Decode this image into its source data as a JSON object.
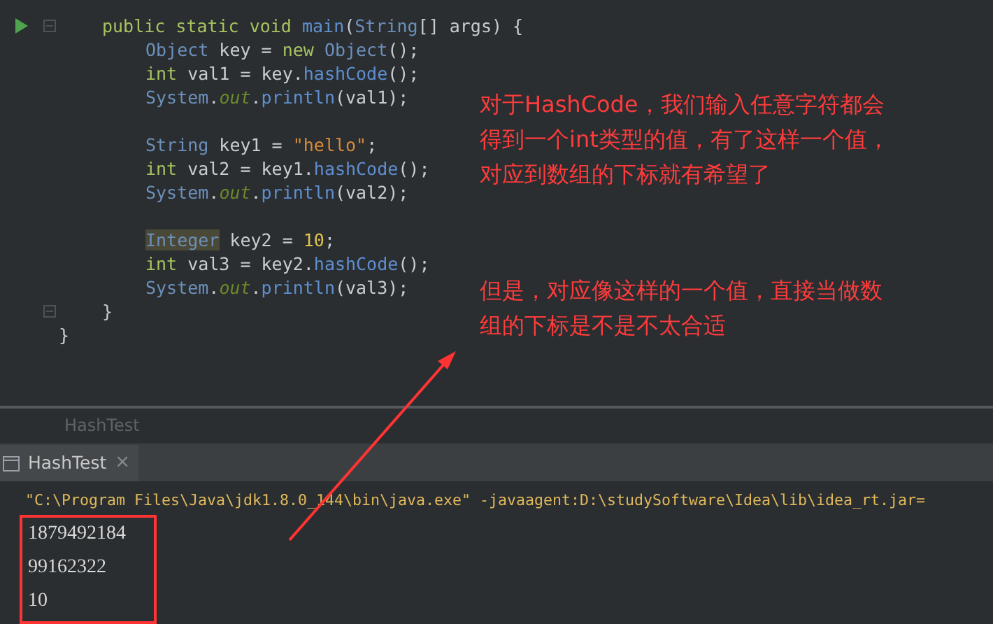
{
  "editor": {
    "lines": [
      {
        "children": [
          {
            "run": true,
            "fold": true,
            "tokens": [
              {
                "kind": "keyword",
                "text": "public static void "
              },
              {
                "kind": "method",
                "text": "main"
              },
              {
                "kind": "plain",
                "text": "("
              },
              {
                "kind": "type",
                "text": "String"
              },
              {
                "kind": "plain",
                "text": "[] args) {"
              }
            ],
            "children": [
              {
                "tokens": [
                  {
                    "kind": "type",
                    "text": "Object"
                  },
                  {
                    "kind": "plain",
                    "text": " key = "
                  },
                  {
                    "kind": "keyword",
                    "text": "new "
                  },
                  {
                    "kind": "type",
                    "text": "Object"
                  },
                  {
                    "kind": "plain",
                    "text": "();"
                  }
                ]
              },
              {
                "tokens": [
                  {
                    "kind": "keyword",
                    "text": "int"
                  },
                  {
                    "kind": "plain",
                    "text": " val1 = key."
                  },
                  {
                    "kind": "method",
                    "text": "hashCode"
                  },
                  {
                    "kind": "plain",
                    "text": "();"
                  }
                ]
              },
              {
                "tokens": [
                  {
                    "kind": "type",
                    "text": "System"
                  },
                  {
                    "kind": "plain",
                    "text": "."
                  },
                  {
                    "kind": "static",
                    "text": "out"
                  },
                  {
                    "kind": "plain",
                    "text": "."
                  },
                  {
                    "kind": "method",
                    "text": "println"
                  },
                  {
                    "kind": "plain",
                    "text": "(val1);"
                  }
                ]
              },
              {
                "gap_before": true,
                "tokens": [
                  {
                    "kind": "type",
                    "text": "String"
                  },
                  {
                    "kind": "plain",
                    "text": " key1 = "
                  },
                  {
                    "kind": "string",
                    "text": "\"hello\""
                  },
                  {
                    "kind": "plain",
                    "text": ";"
                  }
                ]
              },
              {
                "tokens": [
                  {
                    "kind": "keyword",
                    "text": "int"
                  },
                  {
                    "kind": "plain",
                    "text": " val2 = key1."
                  },
                  {
                    "kind": "method",
                    "text": "hashCode"
                  },
                  {
                    "kind": "plain",
                    "text": "();"
                  }
                ]
              },
              {
                "tokens": [
                  {
                    "kind": "type",
                    "text": "System"
                  },
                  {
                    "kind": "plain",
                    "text": "."
                  },
                  {
                    "kind": "static",
                    "text": "out"
                  },
                  {
                    "kind": "plain",
                    "text": "."
                  },
                  {
                    "kind": "method",
                    "text": "println"
                  },
                  {
                    "kind": "plain",
                    "text": "(val2);"
                  }
                ]
              },
              {
                "gap_before": true,
                "tokens": [
                  {
                    "kind": "highlight",
                    "text": "Integer"
                  },
                  {
                    "kind": "plain",
                    "text": " key2 = "
                  },
                  {
                    "kind": "number",
                    "text": "10"
                  },
                  {
                    "kind": "plain",
                    "text": ";"
                  }
                ]
              },
              {
                "tokens": [
                  {
                    "kind": "keyword",
                    "text": "int"
                  },
                  {
                    "kind": "plain",
                    "text": " val3 = key2."
                  },
                  {
                    "kind": "method",
                    "text": "hashCode"
                  },
                  {
                    "kind": "plain",
                    "text": "();"
                  }
                ]
              },
              {
                "tokens": [
                  {
                    "kind": "type",
                    "text": "System"
                  },
                  {
                    "kind": "plain",
                    "text": "."
                  },
                  {
                    "kind": "static",
                    "text": "out"
                  },
                  {
                    "kind": "plain",
                    "text": "."
                  },
                  {
                    "kind": "method",
                    "text": "println"
                  },
                  {
                    "kind": "plain",
                    "text": "(val3);"
                  }
                ]
              }
            ]
          },
          {
            "fold": true,
            "tokens": [
              {
                "kind": "plain",
                "text": "}"
              }
            ]
          }
        ]
      },
      {
        "tokens": [
          {
            "kind": "plain",
            "text": "}"
          }
        ]
      }
    ]
  },
  "annotations": [
    "对于HashCode，我们输入任意字符都会得到一个int类型的值，有了这样一个值，对应到数组的下标就有希望了",
    "但是，对应像这样的一个值，直接当做数组的下标是不是不太合适"
  ],
  "breadcrumb": "HashTest",
  "run_tab": {
    "label": "HashTest",
    "close": "×"
  },
  "console": {
    "command": "\"C:\\Program Files\\Java\\jdk1.8.0_144\\bin\\java.exe\" -javaagent:D:\\studySoftware\\Idea\\lib\\idea_rt.jar=",
    "output": [
      "1879492184",
      "99162322",
      "10"
    ]
  }
}
